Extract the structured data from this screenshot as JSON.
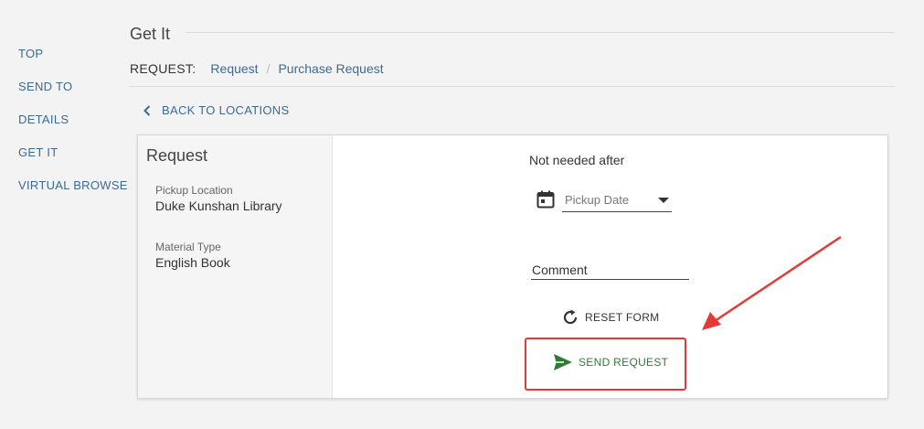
{
  "nav": {
    "items": [
      "TOP",
      "SEND TO",
      "DETAILS",
      "GET IT",
      "VIRTUAL BROWSE"
    ]
  },
  "header": {
    "title": "Get It"
  },
  "breadcrumb": {
    "label": "REQUEST:",
    "items": [
      "Request",
      "Purchase Request"
    ],
    "separator": "/"
  },
  "back_label": "BACK TO LOCATIONS",
  "request_panel": {
    "title": "Request",
    "pickup_location_label": "Pickup Location",
    "pickup_location_value": "Duke Kunshan Library",
    "material_type_label": "Material Type",
    "material_type_value": "English Book"
  },
  "form": {
    "not_needed_after": "Not needed after",
    "pickup_date_placeholder": "Pickup Date",
    "comment_placeholder": "Comment",
    "reset_label": "RESET FORM",
    "send_label": "SEND REQUEST"
  },
  "colors": {
    "link": "#3d6a93",
    "send_green": "#2e7d32",
    "highlight_red": "#e53935"
  },
  "icons": [
    "chevron-left-icon",
    "calendar-icon",
    "dropdown-caret-icon",
    "refresh-icon",
    "send-icon",
    "annotation-arrow"
  ]
}
